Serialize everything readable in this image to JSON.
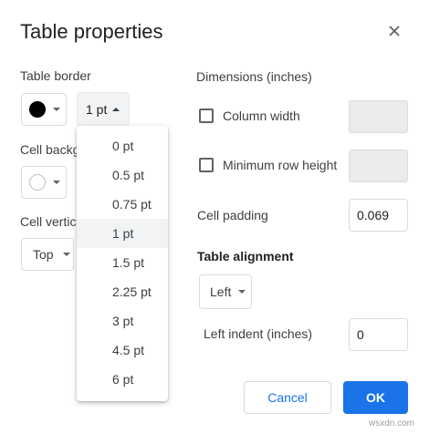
{
  "dialog": {
    "title": "Table properties",
    "close_icon": "close-icon"
  },
  "left": {
    "table_border_label": "Table border",
    "border_color": "#000000",
    "border_width_value": "1 pt",
    "cell_background_label": "Cell backg",
    "cell_background_color": "#ffffff",
    "cell_vertical_label": "Cell vertic",
    "cell_vertical_value": "Top"
  },
  "border_width_menu": {
    "options": [
      "0 pt",
      "0.5 pt",
      "0.75 pt",
      "1 pt",
      "1.5 pt",
      "2.25 pt",
      "3 pt",
      "4.5 pt",
      "6 pt"
    ],
    "selected": "1 pt"
  },
  "right": {
    "dimensions_label": "Dimensions  (inches)",
    "column_width_label": "Column width",
    "column_width_checked": false,
    "min_row_height_label": "Minimum row height",
    "min_row_height_checked": false,
    "cell_padding_label": "Cell padding",
    "cell_padding_value": "0.069",
    "table_alignment_label": "Table alignment",
    "table_alignment_value": "Left",
    "left_indent_label": "Left indent  (inches)",
    "left_indent_value": "0"
  },
  "footer": {
    "cancel_label": "Cancel",
    "ok_label": "OK",
    "accent_color": "#1a73e8"
  },
  "watermark": "wsxdn.com"
}
